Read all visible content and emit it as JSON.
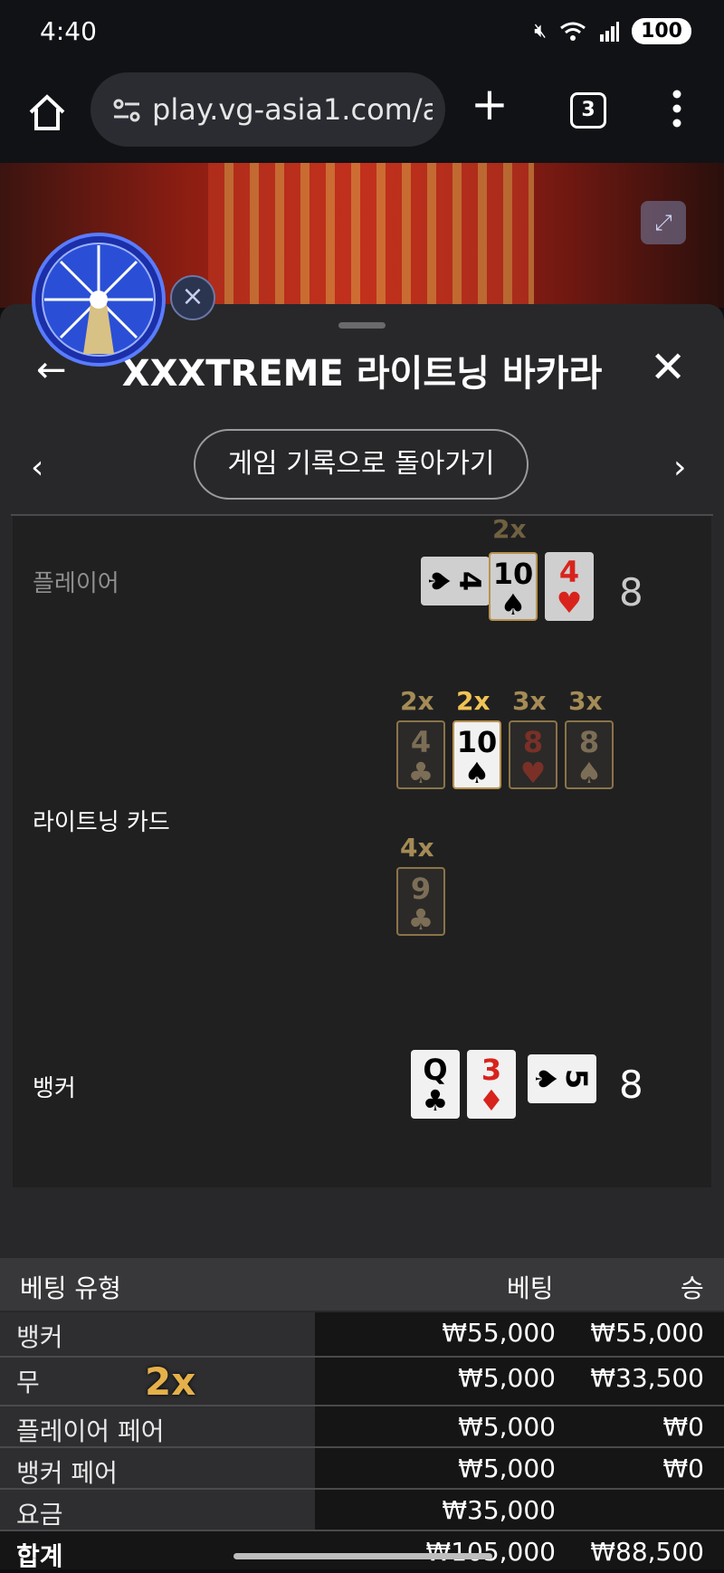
{
  "status_bar": {
    "time": "4:40",
    "battery": "100"
  },
  "browser": {
    "url": "play.vg-asia1.com/ae",
    "tab_count": "3",
    "new_tab": "+"
  },
  "panel": {
    "title": "XXXTREME 라이트닝 바카라",
    "back_to_history": "게임 기록으로 돌아가기"
  },
  "result": {
    "player": {
      "label": "플레이어",
      "score": "8",
      "multiplier": "2x",
      "cards": [
        {
          "rank": "4",
          "suit": "♠"
        },
        {
          "rank": "10",
          "suit": "♠"
        },
        {
          "rank": "4",
          "suit": "♥"
        }
      ]
    },
    "lightning": {
      "label": "라이트닝 카드",
      "cards": [
        {
          "rank": "4",
          "suit": "♣",
          "mult": "2x"
        },
        {
          "rank": "10",
          "suit": "♠",
          "mult": "2x"
        },
        {
          "rank": "8",
          "suit": "♥",
          "mult": "3x"
        },
        {
          "rank": "8",
          "suit": "♠",
          "mult": "3x"
        },
        {
          "rank": "9",
          "suit": "♣",
          "mult": "4x"
        }
      ]
    },
    "banker": {
      "label": "뱅커",
      "score": "8",
      "cards": [
        {
          "rank": "Q",
          "suit": "♣"
        },
        {
          "rank": "3",
          "suit": "♦"
        },
        {
          "rank": "5",
          "suit": "♠"
        }
      ]
    }
  },
  "bets": {
    "headers": {
      "type": "베팅 유형",
      "bet": "베팅",
      "win": "승"
    },
    "tie_multiplier": "2x",
    "rows": [
      {
        "name": "뱅커",
        "bet": "₩55,000",
        "win": "₩55,000"
      },
      {
        "name": "무",
        "bet": "₩5,000",
        "win": "₩33,500"
      },
      {
        "name": "플레이어 페어",
        "bet": "₩5,000",
        "win": "₩0"
      },
      {
        "name": "뱅커 페어",
        "bet": "₩5,000",
        "win": "₩0"
      },
      {
        "name": "요금",
        "bet": "₩35,000",
        "win": ""
      },
      {
        "name": "합계",
        "bet": "₩105,000",
        "win": "₩88,500"
      }
    ]
  }
}
